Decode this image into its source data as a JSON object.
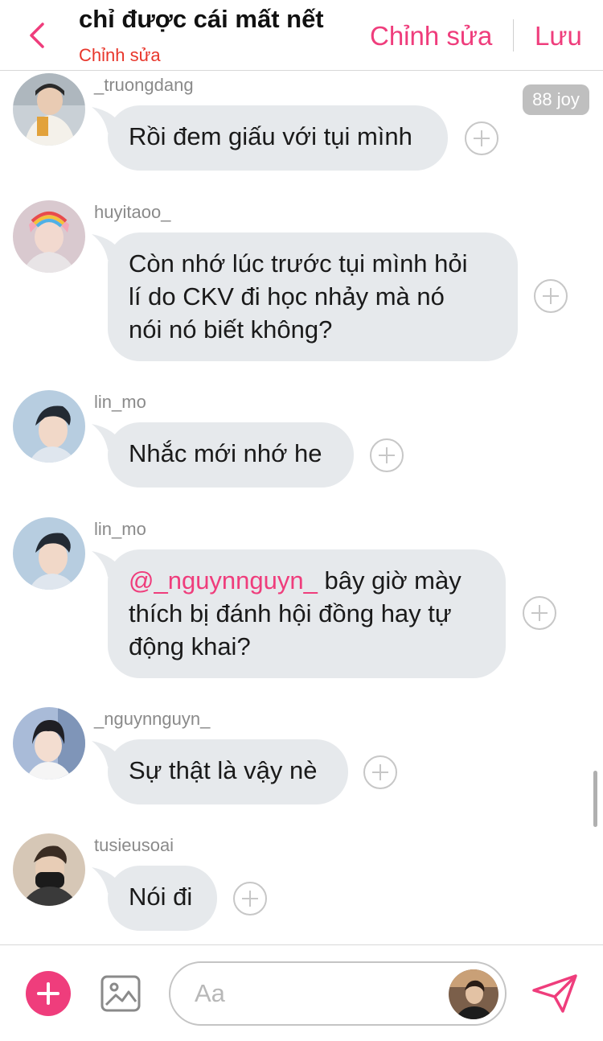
{
  "header": {
    "title": "chỉ được cái mất nết",
    "subtitle": "Chỉnh sửa",
    "edit_label": "Chỉnh sửa",
    "save_label": "Lưu"
  },
  "messages": [
    {
      "username": "_truongdang",
      "text": "Rồi đem giấu với tụi mình",
      "badge": "88 joy"
    },
    {
      "username": "huyitaoo_",
      "lines": [
        "Còn nhớ lúc trước tụi mình hỏi",
        "lí do CKV đi học nhảy mà nó",
        "nói nó biết không?"
      ]
    },
    {
      "username": "lin_mo",
      "text": "Nhắc mới nhớ he"
    },
    {
      "username": "lin_mo",
      "mention": "@_nguynnguyn_",
      "line1_rest": " bây giờ mày",
      "line2": "thích bị đánh hội đồng hay tự",
      "line3": "động khai?"
    },
    {
      "username": "_nguynnguyn_",
      "text": "Sự thật là vậy nè"
    },
    {
      "username": "tusieusoai",
      "text": "Nói đi"
    }
  ],
  "composer": {
    "placeholder": "Aa"
  },
  "colors": {
    "accent": "#ef3d7c",
    "subtitle": "#e8362b",
    "bubble": "#e6e9ec"
  }
}
